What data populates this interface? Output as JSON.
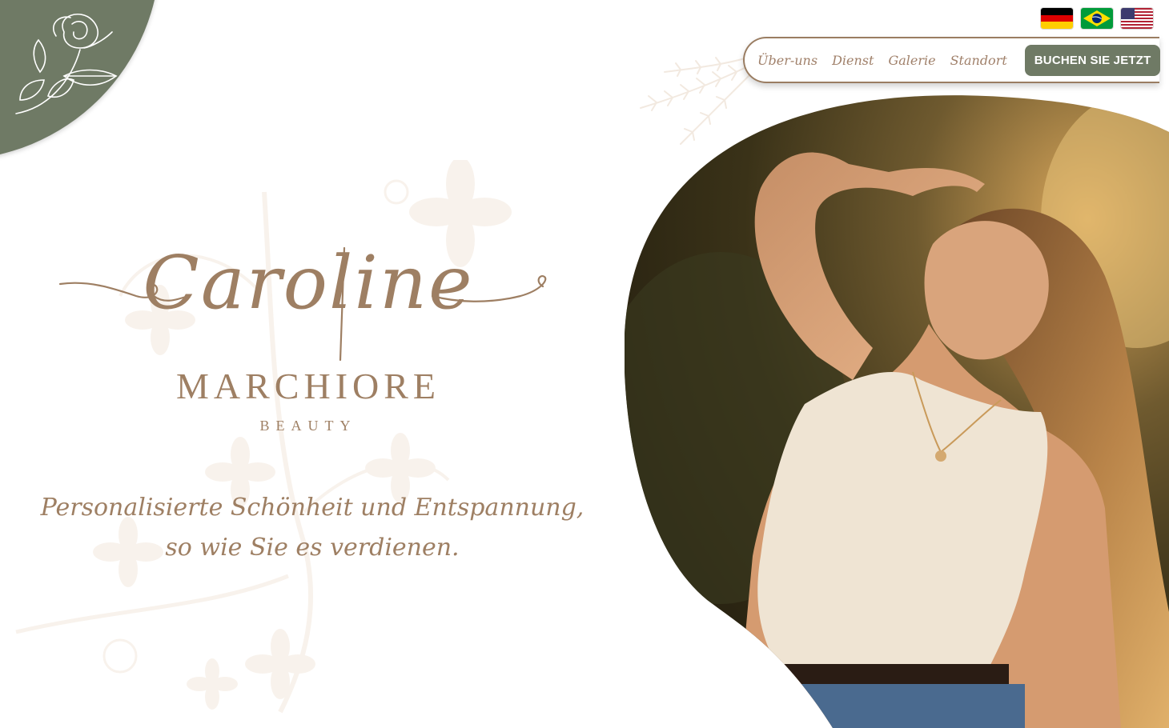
{
  "header": {
    "languages": [
      {
        "name": "Deutsch",
        "code": "de"
      },
      {
        "name": "Português",
        "code": "pt"
      },
      {
        "name": "English",
        "code": "en"
      }
    ]
  },
  "nav": {
    "links": [
      "Über-uns",
      "Dienst",
      "Galerie",
      "Standort"
    ],
    "cta_label": "BUCHEN SIE JETZT"
  },
  "logo": {
    "script": "Caroline",
    "name": "MARCHIORE",
    "sub": "BEAUTY"
  },
  "tagline": {
    "line1": "Personalisierte Schönheit und Entspannung,",
    "line2": "so wie Sie es verdienen."
  },
  "colors": {
    "accent_green": "#6f7a65",
    "brand_brown": "#9e7f63",
    "flower_beige": "#ecdccb"
  },
  "icons": {
    "corner": "rose-icon",
    "decor": "wheat-icon"
  }
}
